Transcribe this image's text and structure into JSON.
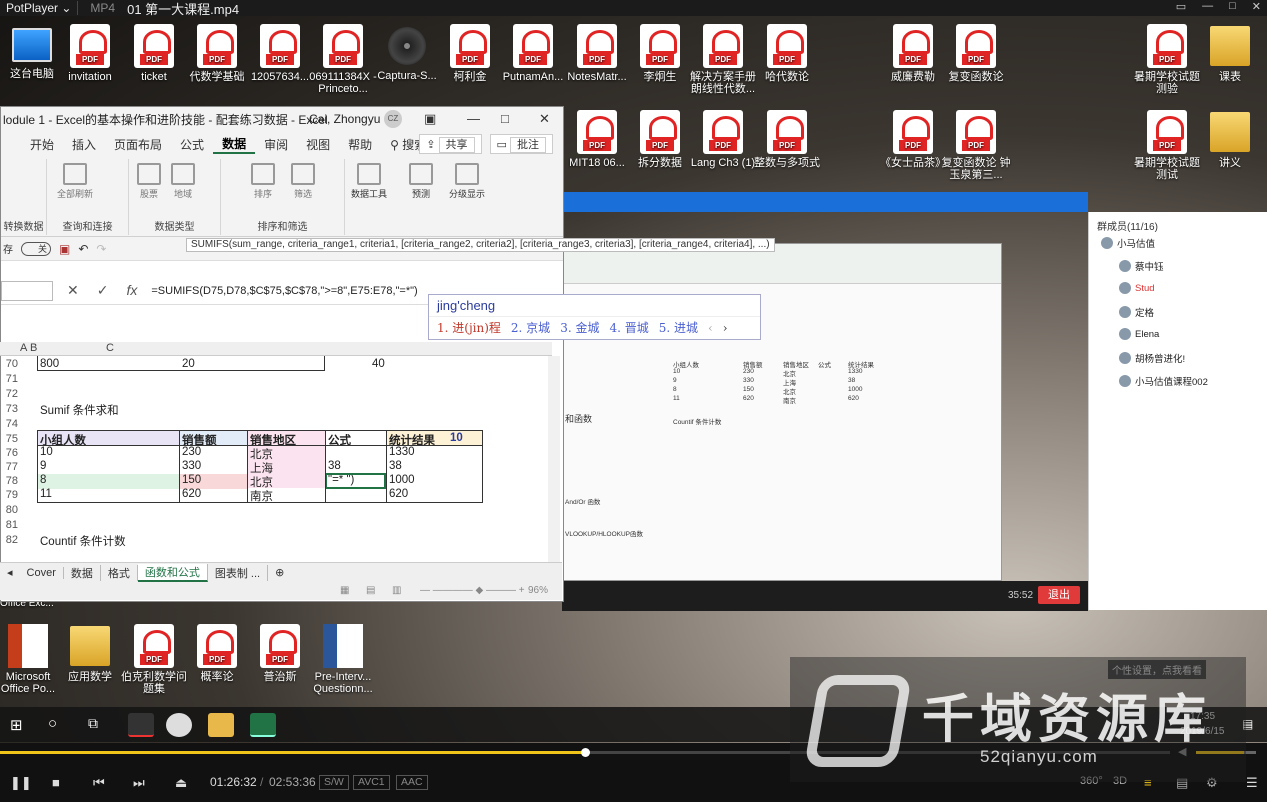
{
  "player": {
    "brand": "PotPlayer",
    "format": "MP4",
    "file_title": "01 第一大课程.mp4",
    "current_time": "01:26:32",
    "separator": "/",
    "total_time": "02:53:36",
    "badges": [
      "S/W",
      "AVC1",
      "AAC"
    ],
    "progress_fraction": 0.5,
    "accent_color": "#f0c419",
    "right_icons": [
      "360°",
      "3D"
    ]
  },
  "desktop": {
    "top_row": [
      {
        "label": "这台电脑",
        "icon": "computer-icon"
      },
      {
        "label": "invitation",
        "icon": "pdf-icon"
      },
      {
        "label": "ticket",
        "icon": "pdf-icon"
      },
      {
        "label": "代数学基础",
        "icon": "pdf-icon"
      },
      {
        "label": "12057634...",
        "icon": "pdf-icon"
      },
      {
        "label": "069111384X - Princeto...",
        "icon": "pdf-icon"
      },
      {
        "label": "Captura-S...",
        "icon": "cd-icon"
      },
      {
        "label": "柯利金",
        "icon": "pdf-icon"
      },
      {
        "label": "PutnamAn...",
        "icon": "pdf-icon"
      },
      {
        "label": "NotesMatr...",
        "icon": "pdf-icon"
      },
      {
        "label": "李炯生",
        "icon": "pdf-icon"
      },
      {
        "label": "解决方案手册 朗线性代数...",
        "icon": "pdf-icon"
      },
      {
        "label": "哈代数论",
        "icon": "pdf-icon"
      },
      {
        "label": "威廉费勒",
        "icon": "pdf-icon"
      },
      {
        "label": "复变函数论",
        "icon": "pdf-icon"
      },
      {
        "label": "暑期学校试题测验",
        "icon": "pdf-icon"
      },
      {
        "label": "课表",
        "icon": "folder-icon"
      }
    ],
    "second_row": [
      {
        "label": "MIT18 06...",
        "icon": "pdf-icon"
      },
      {
        "label": "拆分数据",
        "icon": "pdf-icon"
      },
      {
        "label": "Lang Ch3 (1)",
        "icon": "pdf-icon"
      },
      {
        "label": "整数与多项式",
        "icon": "pdf-icon"
      },
      {
        "label": "《女士品茶》",
        "icon": "pdf-icon"
      },
      {
        "label": "复变函数论 钟玉泉第三...",
        "icon": "pdf-icon"
      },
      {
        "label": "暑期学校试题测试",
        "icon": "pdf-icon"
      },
      {
        "label": "讲义",
        "icon": "folder-icon"
      }
    ],
    "bottom_row": [
      {
        "label": "Microsoft Office Po...",
        "icon": "ppt-icon"
      },
      {
        "label": "应用数学",
        "icon": "folder-icon"
      },
      {
        "label": "伯克利数学问题集",
        "icon": "pdf-icon"
      },
      {
        "label": "概率论",
        "icon": "pdf-icon"
      },
      {
        "label": "普治斯",
        "icon": "pdf-icon"
      },
      {
        "label": "Pre-Interv... Questionn...",
        "icon": "word-icon"
      }
    ],
    "office_label": "Office Exc..."
  },
  "excel": {
    "title": "lodule 1 - Excel的基本操作和进阶技能 - 配套练习数据 - Excel",
    "user": "Cai, Zhongyu",
    "avatar": "CZ",
    "tabs": [
      "开始",
      "插入",
      "页面布局",
      "公式",
      "数据",
      "审阅",
      "视图",
      "帮助"
    ],
    "active_tab": "数据",
    "search": "搜索",
    "share": "共享",
    "comment": "批注",
    "ribbon_groups": [
      {
        "label": "转换数据",
        "buttons": []
      },
      {
        "label": "查询和连接",
        "buttons": [
          "全部刷新"
        ]
      },
      {
        "label": "数据类型",
        "buttons": [
          "股票",
          "地域"
        ]
      },
      {
        "label": "排序和筛选",
        "buttons": [
          "排序",
          "筛选"
        ]
      },
      {
        "label": "",
        "buttons": [
          "数据工具",
          "预测",
          "分级显示"
        ]
      }
    ],
    "qat_save_label": "存",
    "autosave_state": "关",
    "formula": "=SUMIFS(D75,D78,$C$75,$C$78,\">=8\",E75:E78,\"=*\")",
    "tooltip": "SUMIFS(sum_range, criteria_range1, criteria1, [criteria_range2, criteria2], [criteria_range3, criteria3], [criteria_range4, criteria4], ...)",
    "col_headers": [
      "A",
      "B",
      "C"
    ],
    "rows": {
      "r70": {
        "num": "70",
        "c1": "800",
        "c2": "20",
        "c3": "40"
      },
      "r71": {
        "num": "71"
      },
      "r72": {
        "num": "72"
      },
      "r73": {
        "num": "73",
        "title": "Sumif 条件求和"
      },
      "r74": {
        "num": "74"
      },
      "r75": {
        "num": "75",
        "h1": "小组人数",
        "h2": "销售额",
        "h3": "销售地区",
        "h4": "公式",
        "h5": "统计结果",
        "h6": "10"
      },
      "r76": {
        "num": "76",
        "a": "10",
        "b": "230",
        "c": "北京",
        "e": "1330"
      },
      "r77": {
        "num": "77",
        "a": "9",
        "b": "330",
        "c": "上海",
        "d": "38",
        "e": "38"
      },
      "r78": {
        "num": "78",
        "a": "8",
        "b": "150",
        "c": "北京",
        "d": "\"=* \")",
        "e": "1000"
      },
      "r79": {
        "num": "79",
        "a": "11",
        "b": "620",
        "c": "南京",
        "e": "620"
      },
      "r80": {
        "num": "80"
      },
      "r81": {
        "num": "81"
      },
      "r82": {
        "num": "82",
        "title": "Countif 条件计数"
      }
    },
    "sheet_tabs": [
      "Cover",
      "数据",
      "格式",
      "函数和公式",
      "图表制 ..."
    ],
    "active_sheet": "函数和公式",
    "zoom": "96%"
  },
  "ime": {
    "composition": "jing'cheng",
    "candidates": [
      "1. 进(jin)程",
      "2. 京城",
      "3. 金城",
      "4. 晋城",
      "5. 进城"
    ]
  },
  "meeting": {
    "members_header": "群成员(11/16)",
    "members": [
      "小马估值",
      "蔡中钰",
      "Stud",
      "定格",
      "Elena",
      "胡杨曾进化!",
      "小马估值课程002"
    ],
    "call_time": "35:52",
    "exit_label": "退出"
  },
  "shared_screen": {
    "rows": [
      [
        "小组人数",
        "销售额",
        "销售地区",
        "公式",
        "统计结果"
      ],
      [
        "10",
        "230",
        "北京",
        "",
        "1330"
      ],
      [
        "9",
        "330",
        "上海",
        "",
        "38"
      ],
      [
        "8",
        "150",
        "北京",
        "",
        "1000"
      ],
      [
        "11",
        "620",
        "南京",
        "",
        "620"
      ]
    ],
    "countif_title": "Countif 条件计数",
    "notes": [
      "和函数",
      "And/Or 函数",
      "VLOOKUP/HLOOKUP函数"
    ]
  },
  "watermark": {
    "title": "千域资源库",
    "url": "52qianyu.com"
  },
  "tooltip_personal": "个性设置，点我看看",
  "clock": {
    "time": "17:35",
    "date": "2019/6/15"
  }
}
